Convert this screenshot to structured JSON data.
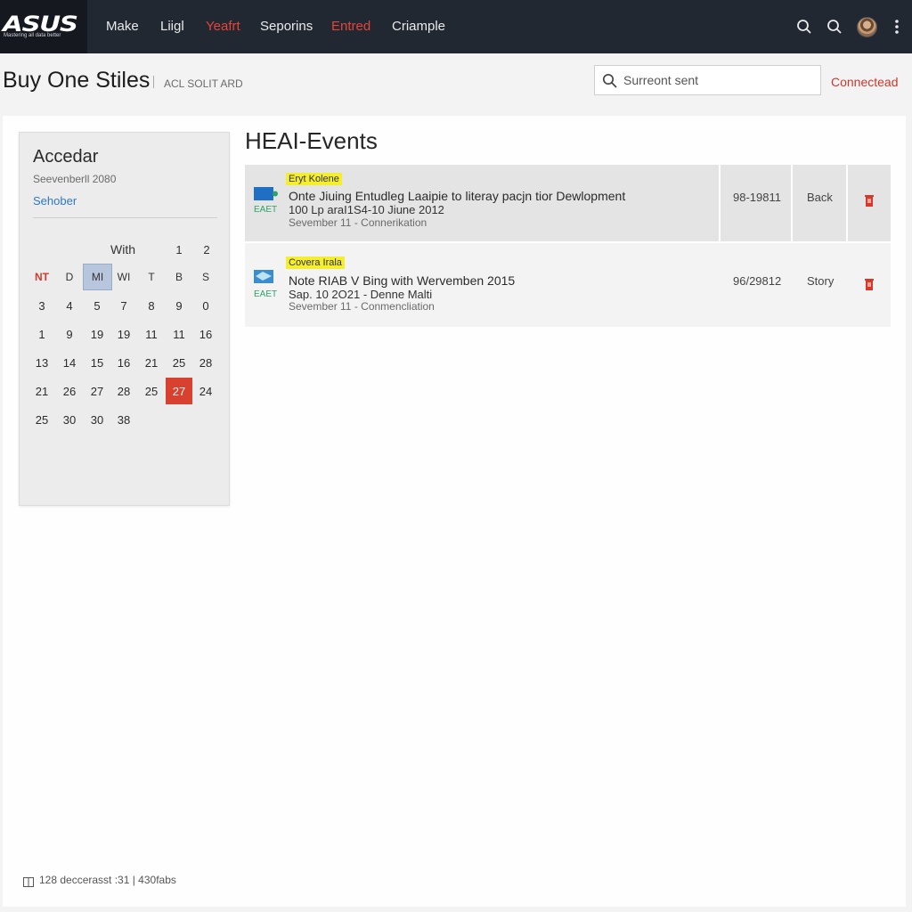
{
  "brand": {
    "logo": "ASUS",
    "tagline": "Mastering all data better"
  },
  "nav": {
    "items": [
      {
        "label": "Make",
        "active": false
      },
      {
        "label": "Liigl",
        "active": false
      },
      {
        "label": "Yeafrt",
        "active": true
      },
      {
        "label": "Seporins",
        "active": false
      },
      {
        "label": "Entred",
        "active": true
      },
      {
        "label": "Criample",
        "active": false
      }
    ],
    "icons": [
      "search-icon",
      "search-icon",
      "avatar"
    ]
  },
  "header": {
    "title": "Buy One Stiles",
    "subtitle": "ACL SOLIT ARD",
    "search_placeholder": "Surreont sent",
    "status": "Connectead"
  },
  "calendar": {
    "title": "Accedar",
    "date": "Seevenberll 2080",
    "link": "Sehober",
    "week_label": "With",
    "top_numbers": [
      "1",
      "2"
    ],
    "weekdays": [
      "NT",
      "D",
      "MI",
      "WI",
      "T",
      "B",
      "S"
    ],
    "rows": [
      [
        "3",
        "4",
        "5",
        "7",
        "8",
        "9",
        "0"
      ],
      [
        "1",
        "9",
        "19",
        "19",
        "11",
        "11",
        "16"
      ],
      [
        "13",
        "14",
        "15",
        "16",
        "21",
        "25",
        "28"
      ],
      [
        "21",
        "26",
        "27",
        "28",
        "25",
        "27",
        "24"
      ],
      [
        "25",
        "30",
        "30",
        "38"
      ]
    ],
    "today": "27"
  },
  "events": {
    "title": "HEAI-Events",
    "items": [
      {
        "tag": "Eryt Kolene",
        "icon_label": "EAET",
        "title": "Onte Jiuing Entudleg Laaipie to literay pacjn tior Dewlopment",
        "subtitle": "100 Lp araI1S4-10 Jiune 2012",
        "meta": "Sevember 11 - Connerikation",
        "date": "98-19811",
        "action": "Back"
      },
      {
        "tag": "Covera Irala",
        "icon_label": "EAET",
        "title": "Note RIAB V Bing with Wervemben 2015",
        "subtitle": "Sap. 10 2O21 - Denne Malti",
        "meta": "Sevember 11 - Conmencliation",
        "date": "96/29812",
        "action": "Story"
      }
    ]
  },
  "footer": {
    "text": "128 deccerasst :31 | 430fabs"
  },
  "colors": {
    "topbar": "#222831",
    "accent_red": "#d8402f",
    "link_blue": "#2e78c2",
    "highlight_yellow": "#f4ee2e"
  }
}
